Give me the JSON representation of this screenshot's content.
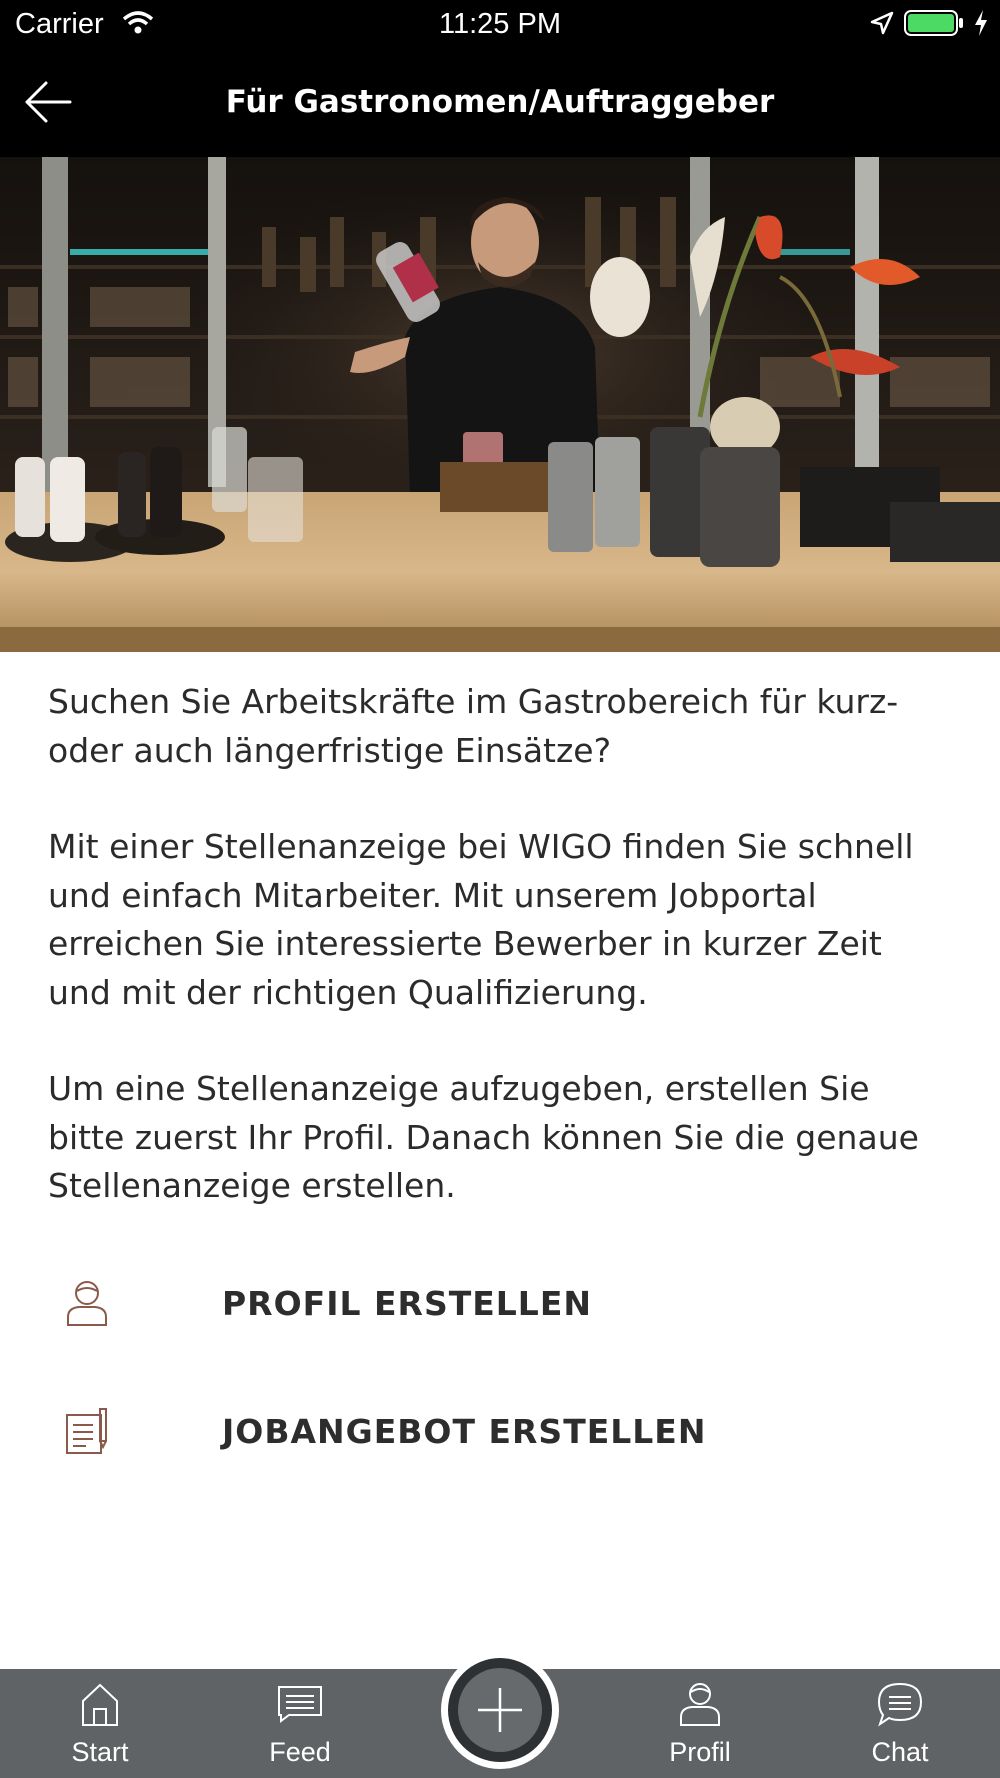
{
  "status_bar": {
    "carrier": "Carrier",
    "time": "11:25 PM"
  },
  "nav": {
    "title": "Für Gastronomen/Auftraggeber",
    "back_icon": "arrow-left-icon"
  },
  "hero": {
    "description": "bartender-photo"
  },
  "content": {
    "paragraphs": [
      "Suchen Sie Arbeitskräfte im Gastrobereich für kurz- oder auch längerfristige Einsätze?",
      "Mit einer Stellenanzeige bei WIGO finden Sie schnell und einfach Mitarbeiter. Mit unserem Jobportal erreichen Sie interessierte Bewerber in kurzer Zeit und mit der richtigen Qualifizierung.",
      "Um eine Stellenanzeige aufzugeben, erstellen Sie bitte zuerst Ihr Profil. Danach können Sie die genaue Stellenanzeige erstellen."
    ]
  },
  "actions": [
    {
      "label": "PROFIL ERSTELLEN",
      "icon": "user-icon"
    },
    {
      "label": "JOBANGEBOT ERSTELLEN",
      "icon": "document-icon"
    }
  ],
  "tabbar": {
    "tabs": [
      {
        "label": "Start",
        "icon": "home-icon"
      },
      {
        "label": "Feed",
        "icon": "feed-icon"
      },
      {
        "label": "Profil",
        "icon": "profile-icon"
      },
      {
        "label": "Chat",
        "icon": "chat-icon"
      }
    ],
    "center_icon": "plus-icon"
  },
  "colors": {
    "accent_icon": "#8a5a4a",
    "tabbar_bg": "#5f6365",
    "header_bg": "#000000"
  }
}
